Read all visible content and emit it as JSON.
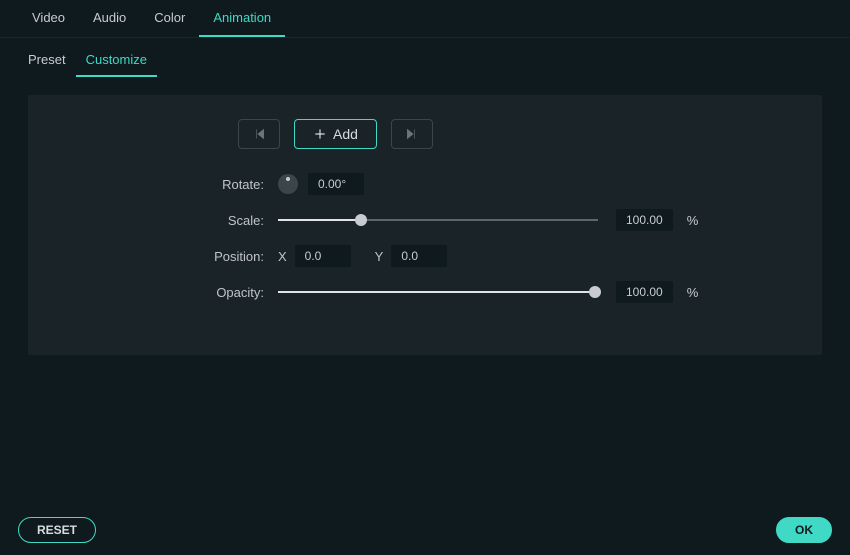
{
  "mainTabs": {
    "t0": "Video",
    "t1": "Audio",
    "t2": "Color",
    "t3": "Animation"
  },
  "subTabs": {
    "t0": "Preset",
    "t1": "Customize"
  },
  "keyframe": {
    "addLabel": "Add"
  },
  "props": {
    "rotateLabel": "Rotate:",
    "rotateValue": "0.00°",
    "scaleLabel": "Scale:",
    "scaleValue": "100.00",
    "scalePercent": 26,
    "positionLabel": "Position:",
    "posXLabel": "X",
    "posXValue": "0.0",
    "posYLabel": "Y",
    "posYValue": "0.0",
    "opacityLabel": "Opacity:",
    "opacityValue": "100.00",
    "opacityPercent": 99,
    "unitPct": "%"
  },
  "footer": {
    "reset": "RESET",
    "ok": "OK"
  }
}
